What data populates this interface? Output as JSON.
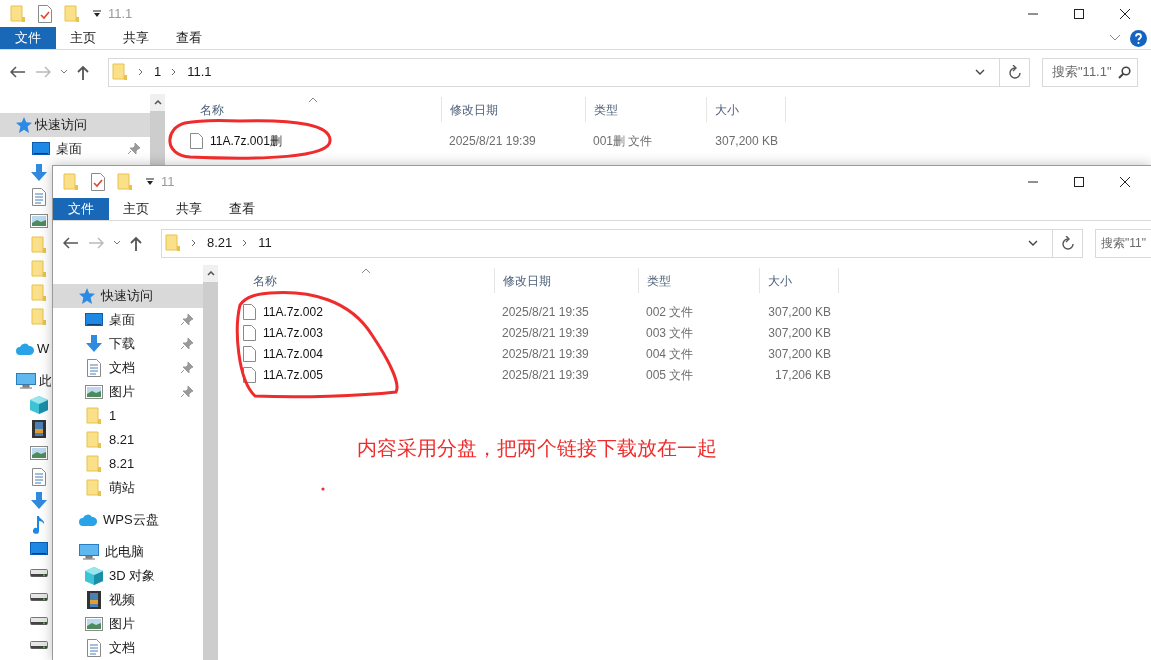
{
  "windows": [
    {
      "title": "11.1",
      "ribbon_tabs": [
        {
          "label": "文件",
          "kind": "file"
        },
        {
          "label": "主页",
          "kind": "tab"
        },
        {
          "label": "共享",
          "kind": "tab"
        },
        {
          "label": "查看",
          "kind": "tab"
        }
      ],
      "path": [
        "1",
        "11.1"
      ],
      "search": {
        "placeholder": "搜索\"11.1\""
      },
      "columns": [
        "名称",
        "修改日期",
        "类型",
        "大小"
      ],
      "rows": [
        {
          "name": "11A.7z.001删",
          "date": "2025/8/21 19:39",
          "type": "001删 文件",
          "size": "307,200 KB"
        }
      ],
      "sidebar": [
        {
          "label": "快速访问",
          "kind": "star",
          "selected": true,
          "children": [
            {
              "label": "桌面",
              "kind": "desktop",
              "selected": false,
              "pinned": true
            },
            {
              "kind": "download",
              "selected": false
            },
            {
              "kind": "document",
              "selected": false
            },
            {
              "kind": "picture",
              "selected": false
            },
            {
              "kind": "folder",
              "selected": false
            },
            {
              "kind": "folder",
              "selected": false
            },
            {
              "kind": "folder",
              "selected": false
            },
            {
              "kind": "folder",
              "selected": false
            }
          ]
        },
        {
          "label": "W",
          "kind": "cloud",
          "selected": false
        },
        {
          "label": "此",
          "kind": "pc",
          "selected": false,
          "children": [
            {
              "kind": "cube",
              "selected": false
            },
            {
              "kind": "video",
              "selected": false
            },
            {
              "kind": "picture",
              "selected": false
            },
            {
              "kind": "document",
              "selected": false
            },
            {
              "kind": "download",
              "selected": false
            },
            {
              "kind": "music",
              "selected": false
            },
            {
              "kind": "desktop",
              "selected": false
            },
            {
              "kind": "drive",
              "selected": false
            },
            {
              "kind": "drive",
              "selected": false
            },
            {
              "kind": "drive",
              "selected": false
            },
            {
              "kind": "drive",
              "selected": false
            }
          ]
        }
      ]
    },
    {
      "title": "11",
      "ribbon_tabs": [
        {
          "label": "文件",
          "kind": "file"
        },
        {
          "label": "主页",
          "kind": "tab"
        },
        {
          "label": "共享",
          "kind": "tab"
        },
        {
          "label": "查看",
          "kind": "tab"
        }
      ],
      "path": [
        "8.21",
        "11"
      ],
      "search": {
        "placeholder": "搜索\"11\""
      },
      "columns": [
        "名称",
        "修改日期",
        "类型",
        "大小"
      ],
      "rows": [
        {
          "name": "11A.7z.002",
          "date": "2025/8/21 19:35",
          "type": "002 文件",
          "size": "307,200 KB"
        },
        {
          "name": "11A.7z.003",
          "date": "2025/8/21 19:39",
          "type": "003 文件",
          "size": "307,200 KB"
        },
        {
          "name": "11A.7z.004",
          "date": "2025/8/21 19:39",
          "type": "004 文件",
          "size": "307,200 KB"
        },
        {
          "name": "11A.7z.005",
          "date": "2025/8/21 19:39",
          "type": "005 文件",
          "size": "17,206 KB"
        }
      ],
      "sidebar": [
        {
          "label": "快速访问",
          "kind": "star",
          "selected": true,
          "children": [
            {
              "label": "桌面",
              "kind": "desktop",
              "selected": false,
              "pinned": true
            },
            {
              "label": "下载",
              "kind": "download",
              "selected": false,
              "pinned": true
            },
            {
              "label": "文档",
              "kind": "document",
              "selected": false,
              "pinned": true
            },
            {
              "label": "图片",
              "kind": "picture",
              "selected": false,
              "pinned": true
            },
            {
              "label": "1",
              "kind": "folder",
              "selected": false,
              "pinned": false
            },
            {
              "label": "8.21",
              "kind": "folder",
              "selected": false,
              "pinned": false
            },
            {
              "label": "8.21",
              "kind": "folder",
              "selected": false,
              "pinned": false
            },
            {
              "label": "萌站",
              "kind": "folder",
              "selected": false,
              "pinned": false
            }
          ]
        },
        {
          "label": "WPS云盘",
          "kind": "cloud",
          "selected": false
        },
        {
          "label": "此电脑",
          "kind": "pc",
          "selected": false,
          "children": [
            {
              "label": "3D 对象",
              "kind": "cube",
              "selected": false
            },
            {
              "label": "视频",
              "kind": "video",
              "selected": false
            },
            {
              "label": "图片",
              "kind": "picture",
              "selected": false
            },
            {
              "label": "文档",
              "kind": "document",
              "selected": false
            }
          ]
        }
      ]
    }
  ],
  "annotation": {
    "note": "内容采用分盘，把两个链接下载放在一起"
  }
}
